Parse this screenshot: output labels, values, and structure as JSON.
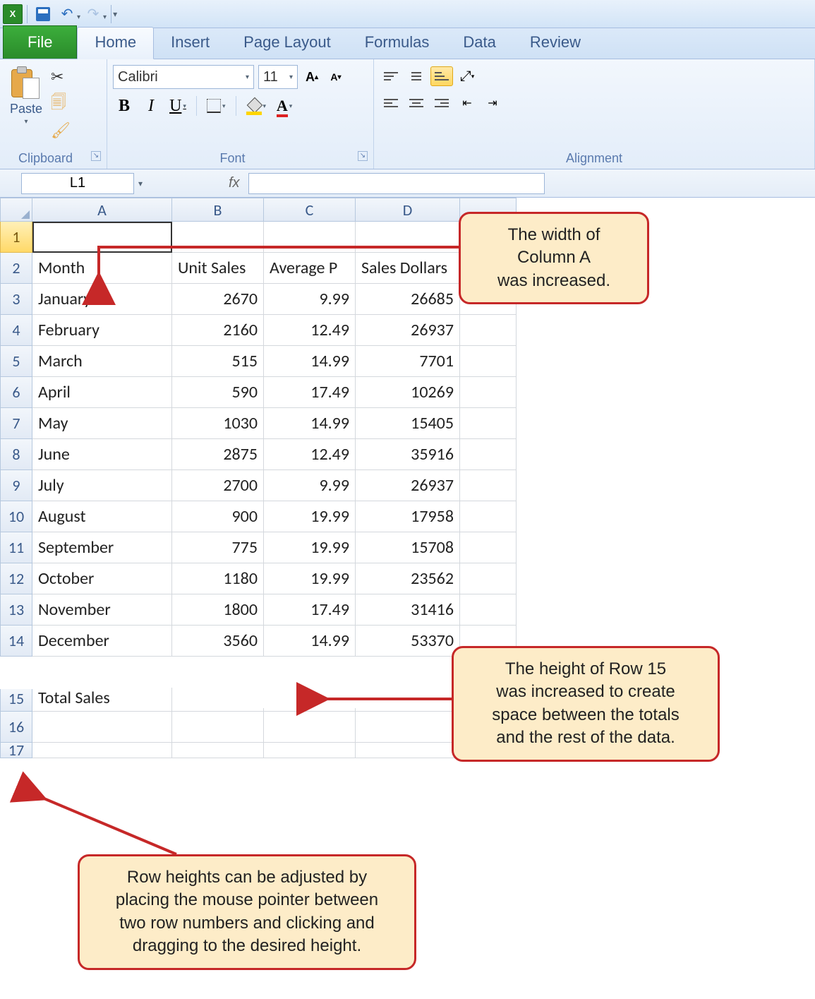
{
  "qat": {
    "app_badge": "X"
  },
  "ribbon": {
    "tabs": [
      "File",
      "Home",
      "Insert",
      "Page Layout",
      "Formulas",
      "Data",
      "Review"
    ],
    "active_tab": "Home",
    "clipboard": {
      "paste": "Paste",
      "label": "Clipboard"
    },
    "font": {
      "name": "Calibri",
      "size": "11",
      "label": "Font"
    },
    "alignment": {
      "label": "Alignment"
    }
  },
  "namebox": "L1",
  "headers": {
    "A": "A",
    "B": "B",
    "C": "C",
    "D": "D"
  },
  "rows": {
    "r2": {
      "A": "Month",
      "B": "Unit Sales",
      "C": "Average P",
      "D": "Sales Dollars"
    },
    "r3": {
      "A": "January",
      "B": "2670",
      "C": "9.99",
      "D": "26685"
    },
    "r4": {
      "A": "February",
      "B": "2160",
      "C": "12.49",
      "D": "26937"
    },
    "r5": {
      "A": "March",
      "B": "515",
      "C": "14.99",
      "D": "7701"
    },
    "r6": {
      "A": "April",
      "B": "590",
      "C": "17.49",
      "D": "10269"
    },
    "r7": {
      "A": "May",
      "B": "1030",
      "C": "14.99",
      "D": "15405"
    },
    "r8": {
      "A": "June",
      "B": "2875",
      "C": "12.49",
      "D": "35916"
    },
    "r9": {
      "A": "July",
      "B": "2700",
      "C": "9.99",
      "D": "26937"
    },
    "r10": {
      "A": "August",
      "B": "900",
      "C": "19.99",
      "D": "17958"
    },
    "r11": {
      "A": "September",
      "B": "775",
      "C": "19.99",
      "D": "15708"
    },
    "r12": {
      "A": "October",
      "B": "1180",
      "C": "19.99",
      "D": "23562"
    },
    "r13": {
      "A": "November",
      "B": "1800",
      "C": "17.49",
      "D": "31416"
    },
    "r14": {
      "A": "December",
      "B": "3560",
      "C": "14.99",
      "D": "53370"
    },
    "r15": {
      "A": "Total Sales"
    }
  },
  "rownums": [
    "1",
    "2",
    "3",
    "4",
    "5",
    "6",
    "7",
    "8",
    "9",
    "10",
    "11",
    "12",
    "13",
    "14",
    "15",
    "16",
    "17"
  ],
  "callouts": {
    "c1": "The width of\nColumn A\nwas increased.",
    "c2": "The height of Row 15\nwas increased to create\nspace between the totals\nand the rest of the data.",
    "c3": "Row heights can be adjusted by\nplacing the mouse pointer between\ntwo row numbers and clicking and\ndragging to the desired height."
  }
}
